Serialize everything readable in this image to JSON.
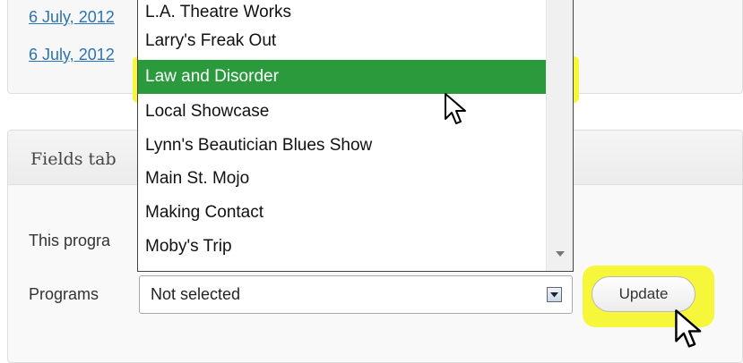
{
  "dates": [
    "6 July, 2012",
    "6 July, 2012"
  ],
  "fields_box": {
    "title": "Fields tab",
    "this_program_text": "This progra",
    "programs_label": "Programs"
  },
  "select": {
    "value": "Not selected"
  },
  "update_button": {
    "label": "Update"
  },
  "dropdown": {
    "items": [
      "L.A. Theatre Works",
      "Larry's Freak Out",
      "Law and Disorder",
      "Local Showcase",
      "Lynn's Beautician Blues Show",
      "Main St. Mojo",
      "Making Contact",
      "Moby's Trip"
    ],
    "selected_index": 2
  },
  "colors": {
    "highlight": "#f6f63a",
    "selected_item_bg": "#2a9a3d",
    "link": "#2a73b8"
  },
  "icons": [
    "chevron-down-icon",
    "mouse-pointer-icon"
  ]
}
